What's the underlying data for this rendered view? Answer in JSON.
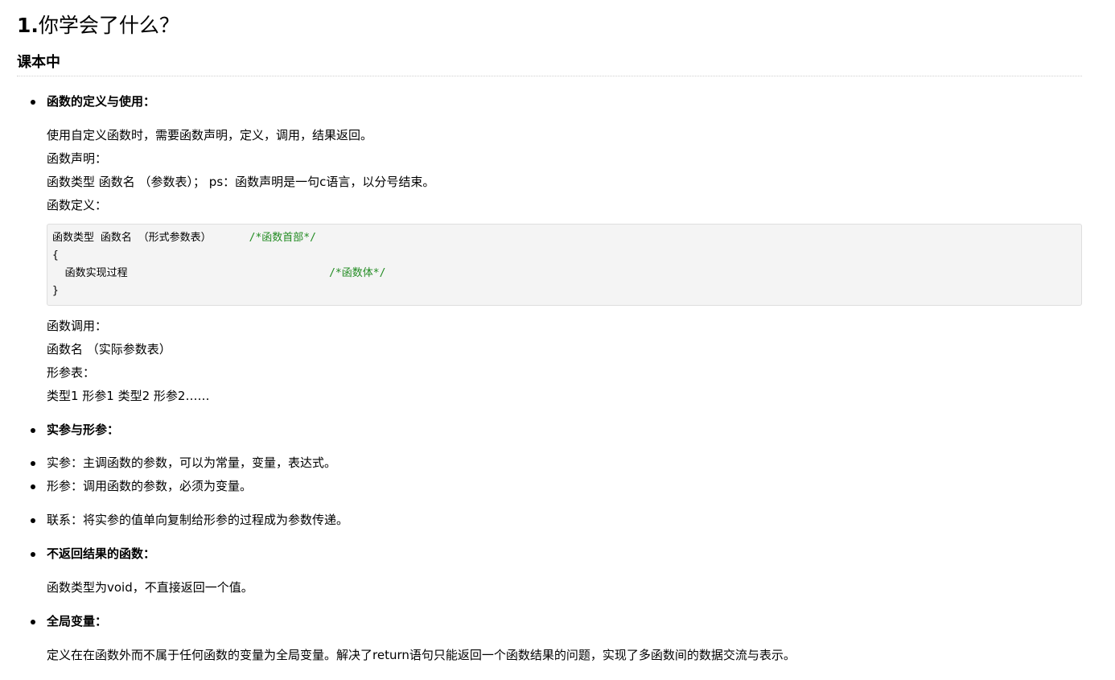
{
  "heading": {
    "number": "1.",
    "title": "你学会了什么？"
  },
  "section": {
    "title": "课本中"
  },
  "func_def": {
    "head": "函数的定义与使用：",
    "p1": "使用自定义函数时，需要函数声明，定义，调用，结果返回。",
    "p2": "函数声明：",
    "p3": "函数类型 函数名 （参数表）；  ps：函数声明是一句c语言，以分号结束。",
    "p4": "函数定义："
  },
  "code": {
    "line1_code": "函数类型 函数名 （形式参数表）      ",
    "line1_comment": "/*函数首部*/",
    "line2": "{",
    "line3_code": "  函数实现过程                                ",
    "line3_comment": "/*函数体*/",
    "line4": "}"
  },
  "func_call": {
    "p1": "函数调用：",
    "p2": "函数名 （实际参数表）",
    "p3": "形参表：",
    "p4": "类型1 形参1 类型2 形参2……"
  },
  "params": {
    "head": "实参与形参：",
    "actual": "实参：主调函数的参数，可以为常量，变量，表达式。",
    "formal": "形参：调用函数的参数，必须为变量。",
    "relation": "联系：将实参的值单向复制给形参的过程成为参数传递。"
  },
  "void_func": {
    "head": "不返回结果的函数：",
    "p1": "函数类型为void，不直接返回一个值。"
  },
  "global_var": {
    "head": "全局变量：",
    "p1": "定义在在函数外而不属于任何函数的变量为全局变量。解决了return语句只能返回一个函数结果的问题，实现了多函数间的数据交流与表示。"
  }
}
